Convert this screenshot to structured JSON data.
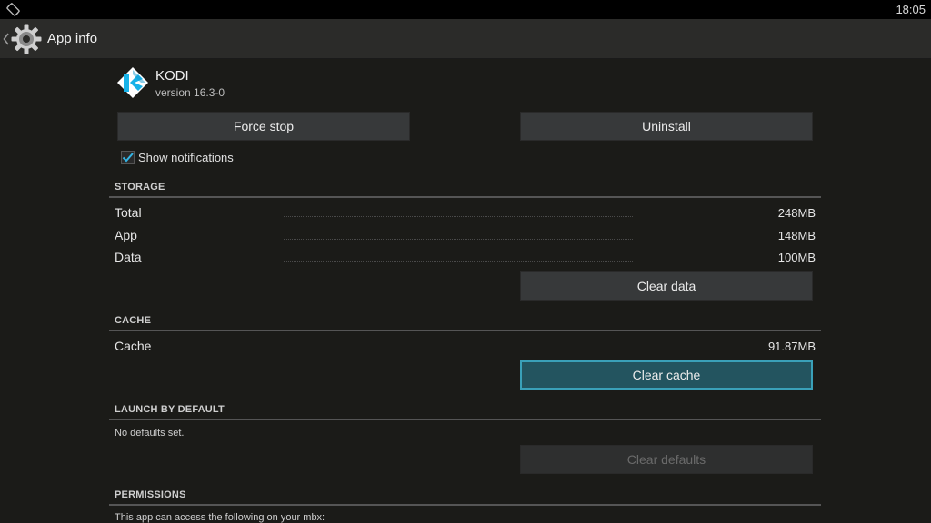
{
  "status_bar": {
    "time": "18:05"
  },
  "action_bar": {
    "title": "App info"
  },
  "app": {
    "name": "KODI",
    "version": "version 16.3-0"
  },
  "buttons": {
    "force_stop": "Force stop",
    "uninstall": "Uninstall",
    "clear_data": "Clear data",
    "clear_cache": "Clear cache",
    "clear_defaults": "Clear defaults"
  },
  "notifications": {
    "label": "Show notifications",
    "checked": true
  },
  "storage": {
    "title": "STORAGE",
    "rows": [
      {
        "label": "Total",
        "value": "248MB"
      },
      {
        "label": "App",
        "value": "148MB"
      },
      {
        "label": "Data",
        "value": "100MB"
      }
    ]
  },
  "cache": {
    "title": "CACHE",
    "rows": [
      {
        "label": "Cache",
        "value": "91.87MB"
      }
    ]
  },
  "launch_by_default": {
    "title": "LAUNCH BY DEFAULT",
    "text": "No defaults set."
  },
  "permissions": {
    "title": "PERMISSIONS",
    "text": "This app can access the following on your mbx:"
  },
  "colors": {
    "accent": "#3aa0b8",
    "focused_button": "#23545f",
    "background": "#1b1b18"
  }
}
